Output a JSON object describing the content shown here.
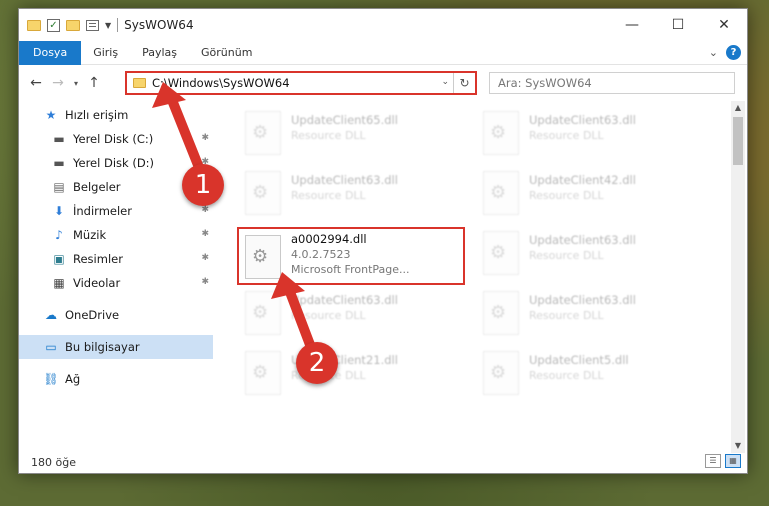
{
  "titlebar": {
    "title": "SysWOW64",
    "minimize": "—",
    "maximize": "☐",
    "close": "✕"
  },
  "ribbon": {
    "tabs": [
      "Dosya",
      "Giriş",
      "Paylaş",
      "Görünüm"
    ],
    "help": "?",
    "collapse": "⌄"
  },
  "nav": {
    "back": "←",
    "forward": "→",
    "recent": "▾",
    "up": "↑",
    "address": "C:\\Windows\\SysWOW64",
    "address_drop": "⌄",
    "refresh": "↻",
    "search_placeholder": "Ara: SysWOW64"
  },
  "sidebar": {
    "items": [
      {
        "label": "Hızlı erişim",
        "icon": "star-icon",
        "glyph": "★"
      },
      {
        "label": "Yerel Disk (C:)",
        "icon": "disk-icon",
        "glyph": "▬",
        "pinned": true
      },
      {
        "label": "Yerel Disk (D:)",
        "icon": "disk-icon",
        "glyph": "▬",
        "pinned": true
      },
      {
        "label": "Belgeler",
        "icon": "document-icon",
        "glyph": "▤",
        "pinned": true
      },
      {
        "label": "İndirmeler",
        "icon": "download-icon",
        "glyph": "⬇",
        "pinned": true
      },
      {
        "label": "Müzik",
        "icon": "music-icon",
        "glyph": "♪",
        "pinned": true
      },
      {
        "label": "Resimler",
        "icon": "pictures-icon",
        "glyph": "▣",
        "pinned": true
      },
      {
        "label": "Videolar",
        "icon": "video-icon",
        "glyph": "▦",
        "pinned": true
      },
      {
        "label": "OneDrive",
        "icon": "cloud-icon",
        "glyph": "☁"
      },
      {
        "label": "Bu bilgisayar",
        "icon": "computer-icon",
        "glyph": "▭"
      },
      {
        "label": "Ağ",
        "icon": "network-icon",
        "glyph": "⛓"
      }
    ],
    "pin_glyph": "📌"
  },
  "files": [
    {
      "name": "UpdateClient65.dll",
      "desc": "Resource DLL"
    },
    {
      "name": "UpdateClient63.dll",
      "desc": "Resource DLL"
    },
    {
      "name": "UpdateClient63.dll",
      "desc": "Resource DLL"
    },
    {
      "name": "UpdateClient42.dll",
      "desc": "Resource DLL"
    },
    {
      "name": "a0002994.dll",
      "version": "4.0.2.7523",
      "desc": "Microsoft FrontPage..."
    },
    {
      "name": "UpdateClient63.dll",
      "desc": "Resource DLL"
    },
    {
      "name": "UpdateClient63.dll",
      "desc": "Resource DLL"
    },
    {
      "name": "UpdateClient63.dll",
      "desc": "Resource DLL"
    },
    {
      "name": "UpdateClient21.dll",
      "desc": "Resource DLL"
    },
    {
      "name": "UpdateClient5.dll",
      "desc": "Resource DLL"
    }
  ],
  "status": {
    "count": "180 öğe"
  },
  "annotations": {
    "step1": "1",
    "step2": "2",
    "color": "#d9342b"
  },
  "colors": {
    "accent": "#1979ca",
    "highlight": "#d9342b",
    "selected": "#cce0f5"
  }
}
